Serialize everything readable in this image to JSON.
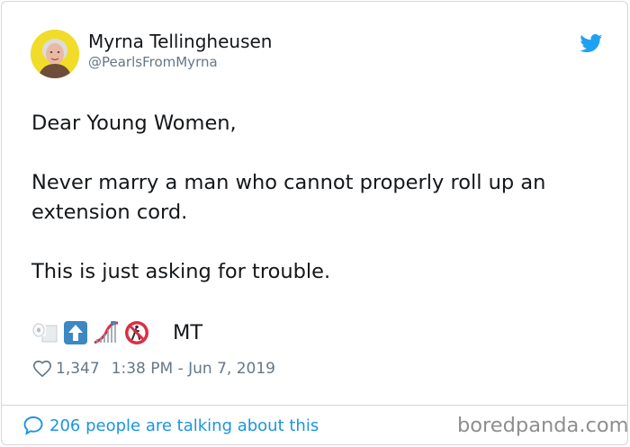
{
  "author": {
    "name": "Myrna Tellingheusen",
    "handle": "@PearlsFromMyrna",
    "avatar_icon": "avatar-photo"
  },
  "tweet": {
    "paragraphs": [
      "Dear Young Women,",
      "Never marry a man who cannot properly roll up an extension cord.",
      "This is just asking for trouble."
    ],
    "paragraph_lines": [
      [
        "Dear Young Women,"
      ],
      [
        "Never marry a man who cannot properly roll up an",
        "extension cord."
      ],
      [
        "This is just asking for trouble."
      ]
    ],
    "emojis": [
      "toilet-roll-icon",
      "up-arrow-icon",
      "roller-coaster-icon",
      "no-pedestrians-icon"
    ],
    "emoji_text": "MT"
  },
  "meta": {
    "like_icon": "heart-icon",
    "likes": "1,347",
    "time": "1:38 PM",
    "separator": "-",
    "date": "Jun 7, 2019"
  },
  "footer": {
    "comment_icon": "speech-bubble-icon",
    "link_text": "206 people are talking about this"
  },
  "watermark": "boredpanda.com",
  "colors": {
    "link": "#1b95e0",
    "muted": "#657786",
    "border": "#cfd9de",
    "twitter_blue": "#1da1f2"
  }
}
